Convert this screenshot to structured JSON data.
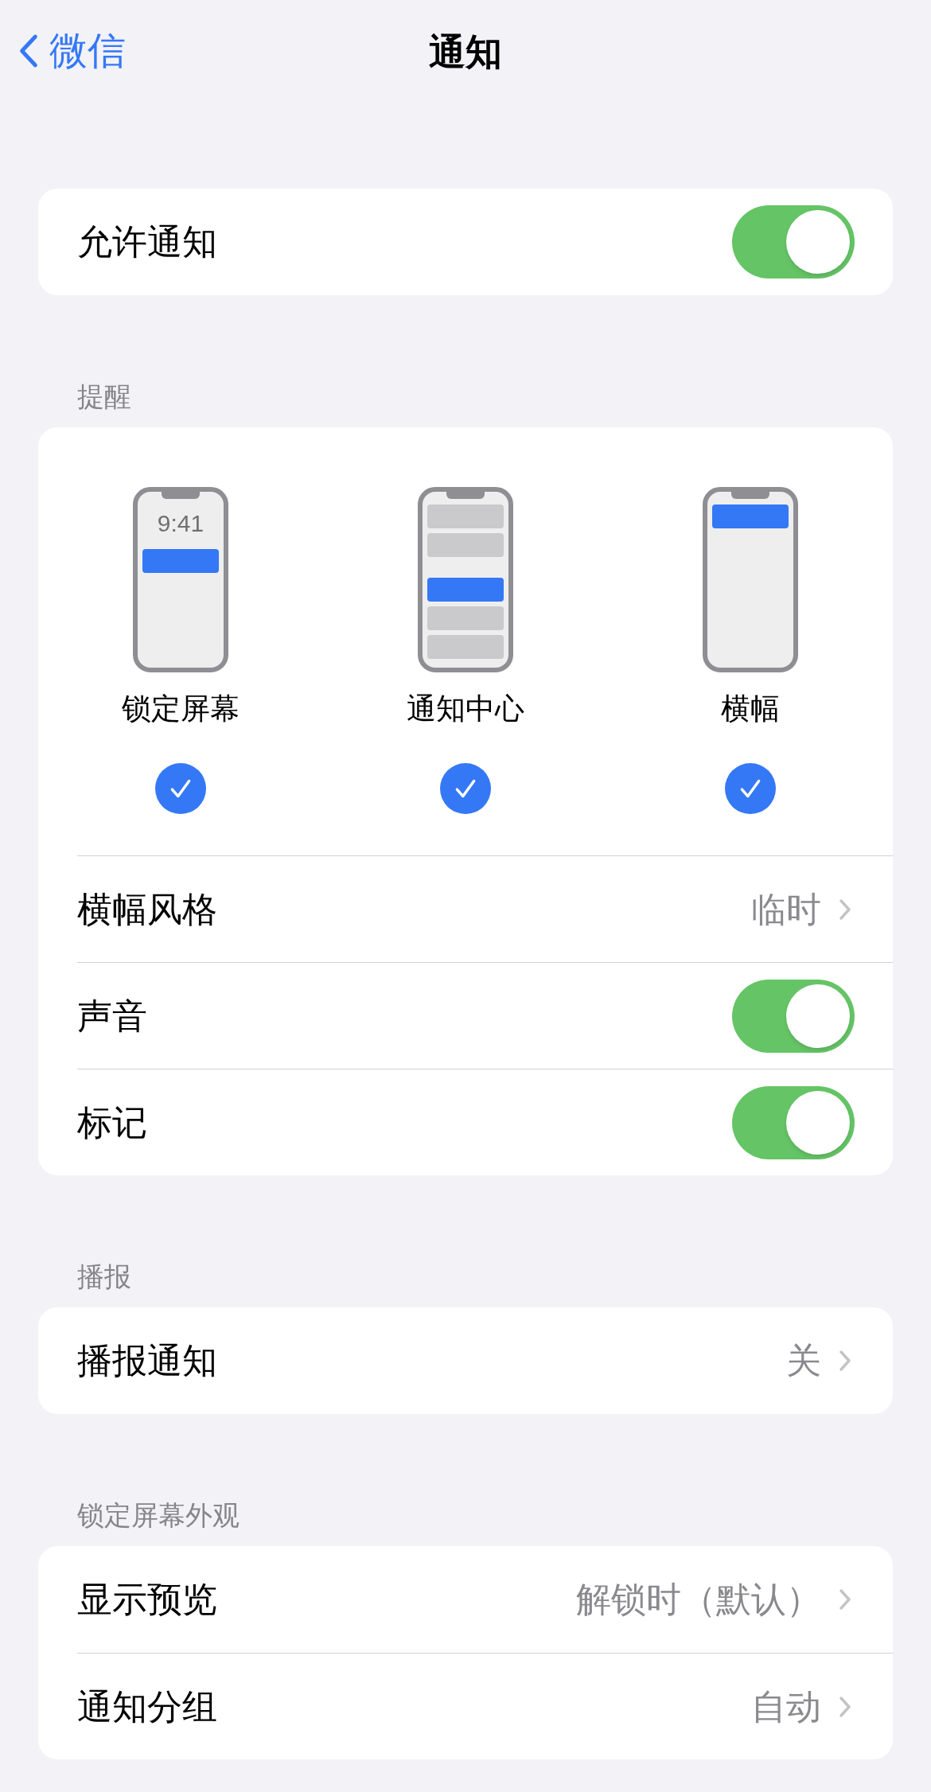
{
  "nav": {
    "back": "微信",
    "title": "通知"
  },
  "sections": [
    {
      "rows": [
        {
          "kind": "toggle",
          "label": "允许通知",
          "on": true
        }
      ]
    },
    {
      "header": "提醒",
      "alerts": [
        {
          "kind": "lockscreen",
          "label": "锁定屏幕",
          "time": "9:41",
          "checked": true
        },
        {
          "kind": "center",
          "label": "通知中心",
          "checked": true
        },
        {
          "kind": "banner",
          "label": "横幅",
          "checked": true
        }
      ],
      "rows": [
        {
          "kind": "link",
          "label": "横幅风格",
          "value": "临时"
        },
        {
          "kind": "toggle",
          "label": "声音",
          "on": true
        },
        {
          "kind": "toggle",
          "label": "标记",
          "on": true
        }
      ]
    },
    {
      "header": "播报",
      "rows": [
        {
          "kind": "link",
          "label": "播报通知",
          "value": "关"
        }
      ]
    },
    {
      "header": "锁定屏幕外观",
      "rows": [
        {
          "kind": "link",
          "label": "显示预览",
          "value": "解锁时（默认）"
        },
        {
          "kind": "link",
          "label": "通知分组",
          "value": "自动"
        }
      ]
    }
  ]
}
